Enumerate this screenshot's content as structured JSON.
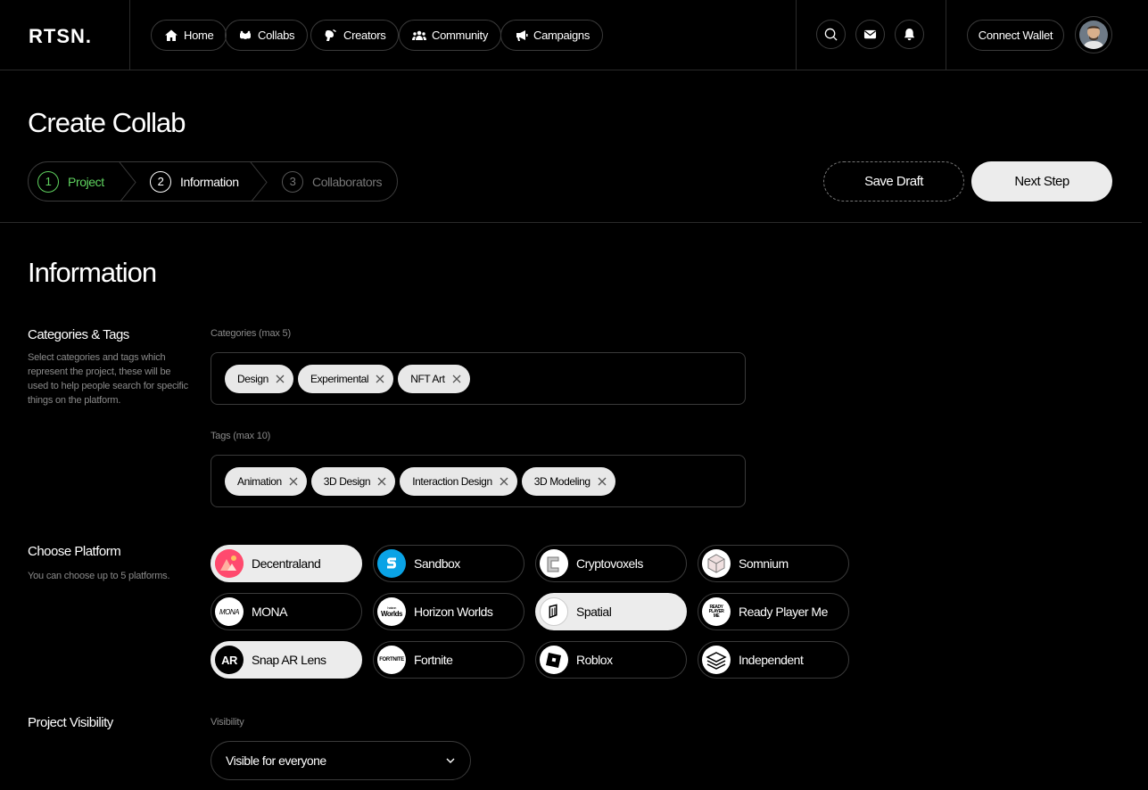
{
  "app": {
    "logo": "RTSN."
  },
  "nav": {
    "items": [
      {
        "label": "Home",
        "icon": "home-icon"
      },
      {
        "label": "Collabs",
        "icon": "collabs-icon"
      },
      {
        "label": "Creators",
        "icon": "creators-icon"
      },
      {
        "label": "Community",
        "icon": "community-icon"
      },
      {
        "label": "Campaigns",
        "icon": "megaphone-icon"
      }
    ],
    "wallet_label": "Connect Wallet"
  },
  "header": {
    "title": "Create Collab",
    "steps": [
      {
        "num": "1",
        "label": "Project",
        "state": "done"
      },
      {
        "num": "2",
        "label": "Information",
        "state": "active"
      },
      {
        "num": "3",
        "label": "Collaborators",
        "state": "todo"
      }
    ],
    "save_draft": "Save Draft",
    "next_step": "Next Step"
  },
  "section": {
    "title": "Information"
  },
  "categories_tags": {
    "label": "Categories & Tags",
    "description": "Select categories and tags which represent the project, these will be used to help people search for specific things on the platform.",
    "categories_label": "Categories (max 5)",
    "categories": [
      "Design",
      "Experimental",
      "NFT Art"
    ],
    "tags_label": "Tags (max 10)",
    "tags": [
      "Animation",
      "3D Design",
      "Interaction Design",
      "3D Modeling"
    ]
  },
  "platform": {
    "label": "Choose Platform",
    "description": "You can choose up to 5 platforms.",
    "items": [
      {
        "name": "Decentraland",
        "selected": true
      },
      {
        "name": "Sandbox",
        "selected": false
      },
      {
        "name": "Cryptovoxels",
        "selected": false
      },
      {
        "name": "Somnium",
        "selected": false
      },
      {
        "name": "MONA",
        "selected": false
      },
      {
        "name": "Horizon Worlds",
        "selected": false
      },
      {
        "name": "Spatial",
        "selected": true
      },
      {
        "name": "Ready Player Me",
        "selected": false
      },
      {
        "name": "Snap AR Lens",
        "selected": true
      },
      {
        "name": "Fortnite",
        "selected": false
      },
      {
        "name": "Roblox",
        "selected": false
      },
      {
        "name": "Independent",
        "selected": false
      }
    ],
    "icon_text": {
      "mona": "MONA",
      "horizon_top": "horizon",
      "horizon": "Worlds",
      "snap": "AR",
      "fortnite": "FORTNITE",
      "rpm": "READY PLAYER ME"
    }
  },
  "visibility": {
    "label": "Project Visibility",
    "field_label": "Visibility",
    "value": "Visible for everyone"
  },
  "colors": {
    "accent_green": "#5fd35f",
    "chip_bg": "#e8e8e8",
    "border": "#3a3a3a"
  }
}
